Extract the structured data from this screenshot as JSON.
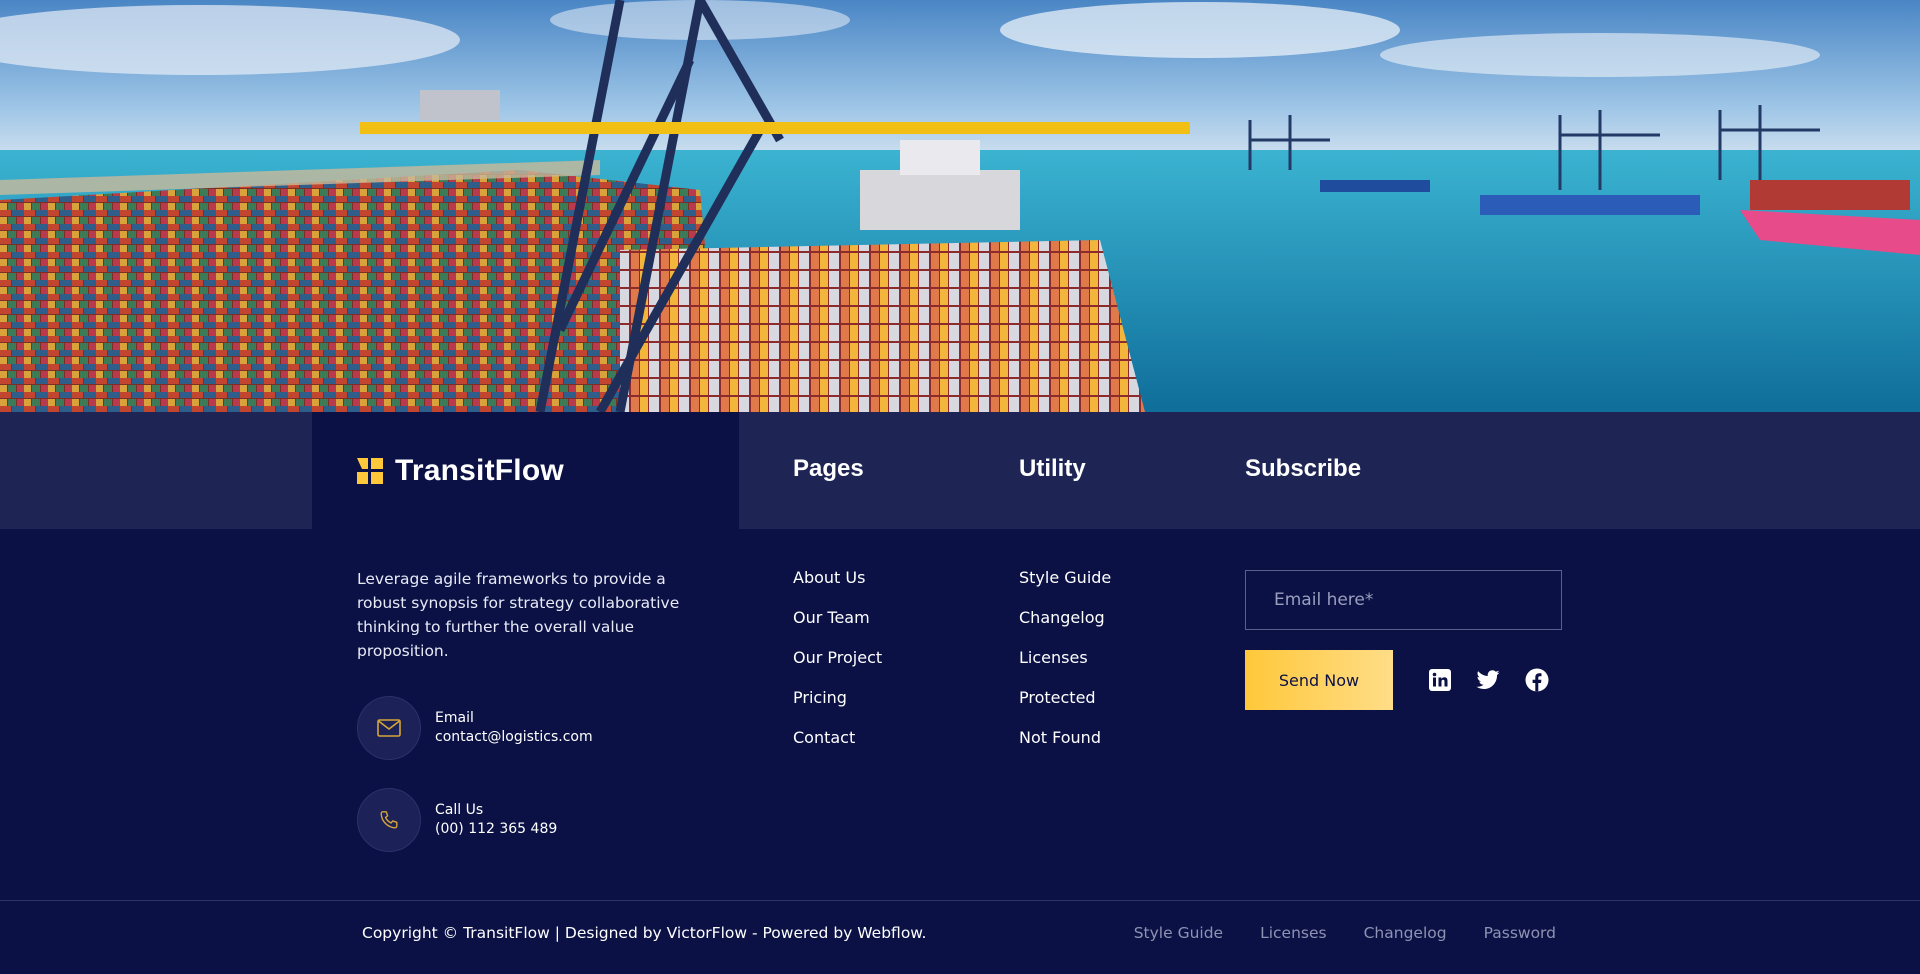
{
  "hero": {
    "image": "port-container-terminal-photo"
  },
  "brand": {
    "name": "TransitFlow",
    "logo_icon": "grid-logo-icon",
    "accent": "#ffc83a"
  },
  "about": {
    "text": "Leverage agile frameworks to provide a robust synopsis for strategy  collaborative thinking to further the overall value proposition."
  },
  "contacts": [
    {
      "icon": "mail-icon",
      "label": "Email",
      "value": "contact@logistics.com"
    },
    {
      "icon": "phone-icon",
      "label": "Call Us",
      "value": "(00) 112 365 489"
    }
  ],
  "pages": {
    "title": "Pages",
    "items": [
      "About Us",
      "Our Team",
      "Our Project",
      "Pricing",
      "Contact"
    ]
  },
  "utility": {
    "title": "Utility",
    "items": [
      "Style Guide",
      "Changelog",
      "Licenses",
      "Protected",
      "Not Found"
    ]
  },
  "subscribe": {
    "title": "Subscribe",
    "email_placeholder": "Email here*",
    "email_value": "",
    "button_label": "Send Now"
  },
  "social": [
    "linkedin-icon",
    "twitter-icon",
    "facebook-icon"
  ],
  "footer": {
    "copyright": "Copyright © TransitFlow | Designed by VictorFlow - Powered by Webflow.",
    "links": [
      "Style Guide",
      "Licenses",
      "Changelog",
      "Password"
    ]
  },
  "colors": {
    "background": "#0b1145",
    "band": "#1e2453",
    "accent": "#ffc83a",
    "muted_link": "#8e93b3"
  }
}
